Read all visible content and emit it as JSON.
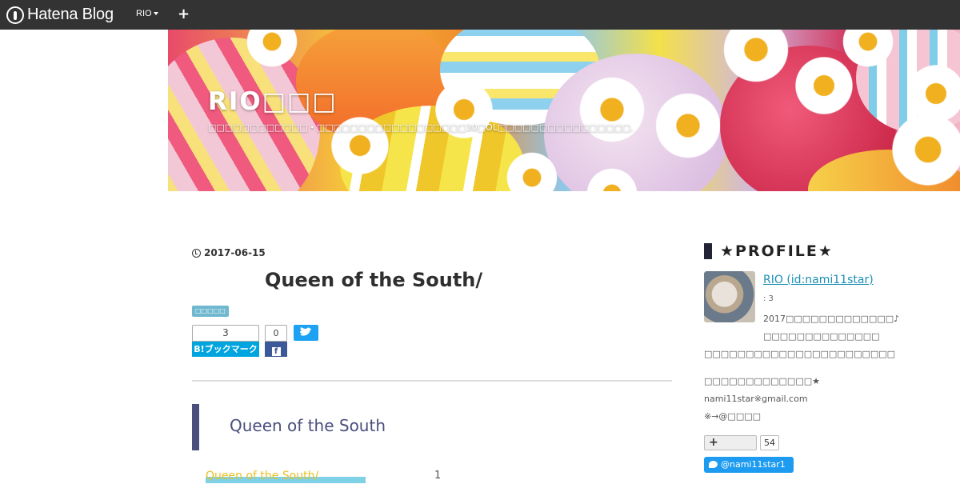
{
  "global_header": {
    "logo_text": "Hatena Blog",
    "user_label": "RIO",
    "add_label": "+"
  },
  "blog": {
    "title": "RIO□□□",
    "description": "□□□□□□□□□□□□・□□□□□□□□□□□□□□□□□□30□OL□□□□□□□□□□□□□□□□."
  },
  "entry": {
    "date": "2017-06-15",
    "title": "Queen of the South/",
    "category": "□□□□□",
    "bookmark_count": "3",
    "bookmark_label": "B!ブックマーク",
    "facebook_count": "0",
    "section_heading": "Queen of the South",
    "toc_link": "Queen of the South/",
    "toc_number": "1"
  },
  "sidebar": {
    "section_title": "★PROFILE★",
    "profile_name": "RIO (id:nami11star)",
    "profile_sub": ": 3",
    "bio_lines": [
      "2017□□□□□□□□□□□□□♪",
      "□□□□□□□□□□□□□□",
      "□□□□□□□□□□□□□□□□□□□□□□□"
    ],
    "contact_lines": [
      "□□□□□□□□□□□□□★",
      "nami11star※gmail.com",
      "※→@□□□□"
    ],
    "follow_count": "54",
    "twitter_handle": "@nami11star1"
  },
  "colors": {
    "header_bg": "#333333",
    "link": "#1b8fb5",
    "heading_accent": "#4a4f7c",
    "hatena_blue": "#00a4de",
    "facebook_blue": "#3b5998",
    "twitter_blue": "#1da1f2",
    "toc_yellow": "#e5c023"
  }
}
